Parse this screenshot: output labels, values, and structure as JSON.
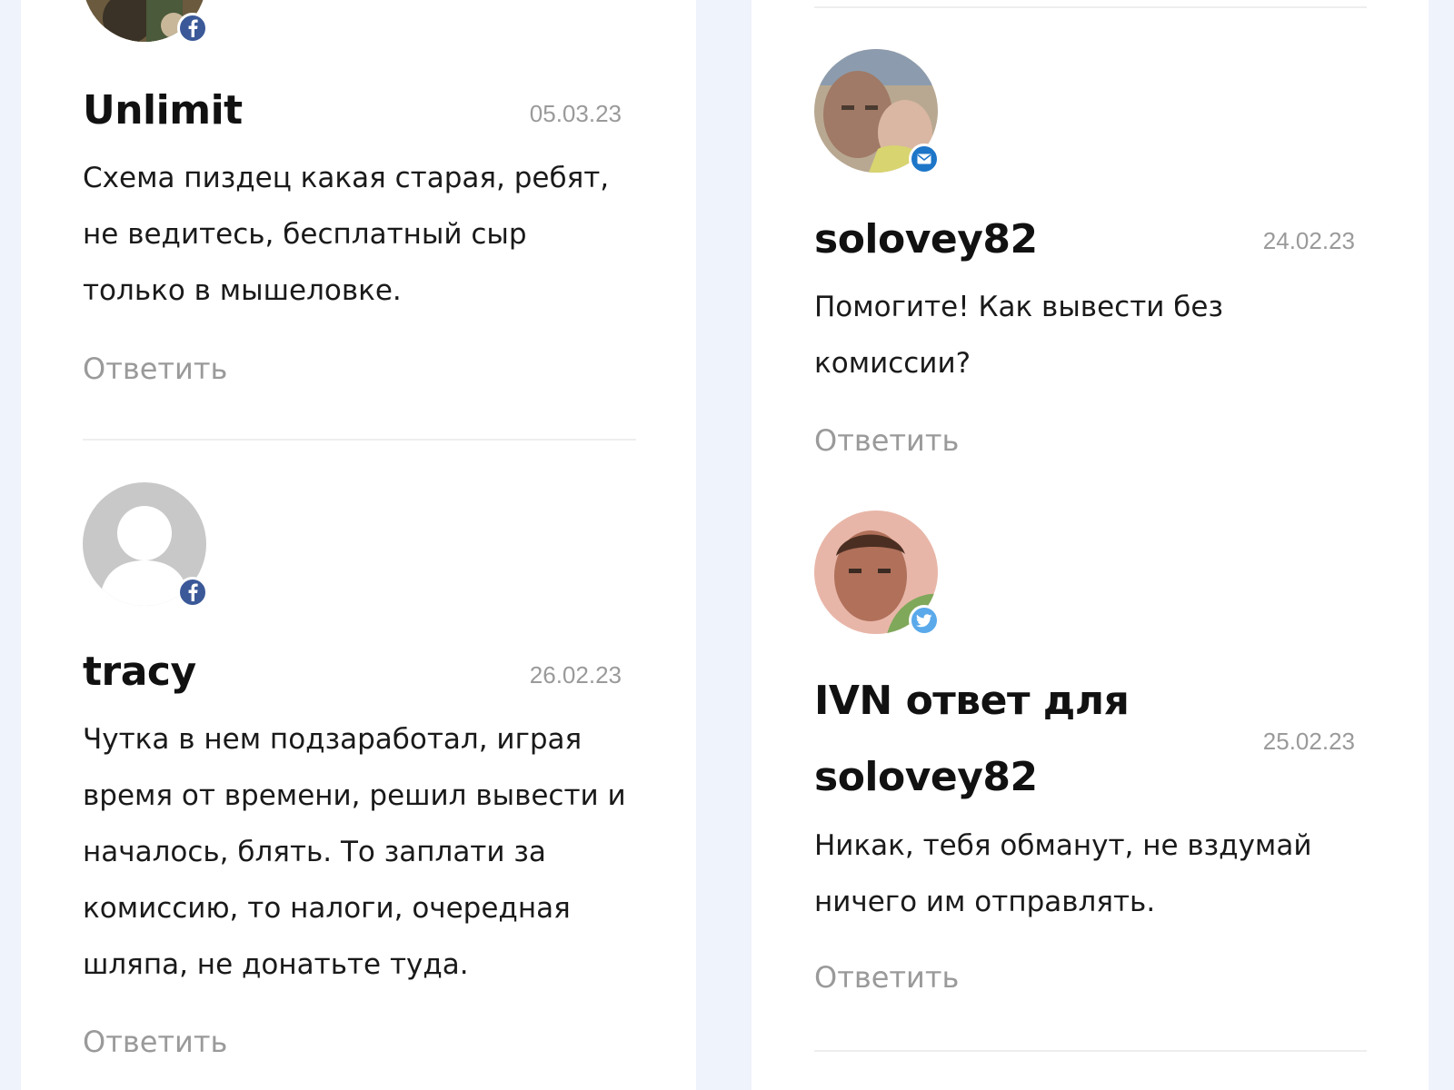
{
  "comments": [
    {
      "author": "Unlimit",
      "date": "05.03.23",
      "text": "Схема пиздец какая старая, ребят, не ведитесь, бесплатный сыр только в мышеловке.",
      "reply_label": "Ответить",
      "avatar_badge": "facebook-icon"
    },
    {
      "author": "tracy",
      "date": "26.02.23",
      "text": "Чутка в нем подзаработал, играя время от времени, решил вывести и началось, блять. То заплати за комиссию, то налоги, очередная шляпа, не донатьте туда.",
      "reply_label": "Ответить",
      "avatar_badge": "facebook-icon"
    },
    {
      "author": "solovey82",
      "date": "24.02.23",
      "text": "Помогите! Как вывести без комиссии?",
      "reply_label": "Ответить",
      "avatar_badge": "mail-icon"
    },
    {
      "author": "IVN ответ для solovey82",
      "date": "25.02.23",
      "text": "Никак, тебя обманут, не вздумай ничего им отправлять.",
      "reply_label": "Ответить",
      "avatar_badge": "twitter-icon"
    }
  ],
  "colors": {
    "page_background": "#eef3fc",
    "card_background": "#ffffff",
    "author_text": "#111111",
    "muted_text": "#9a9a9a",
    "facebook_badge": "#3b5998",
    "mail_badge": "#1e76c8",
    "twitter_badge": "#5aa9ea"
  }
}
